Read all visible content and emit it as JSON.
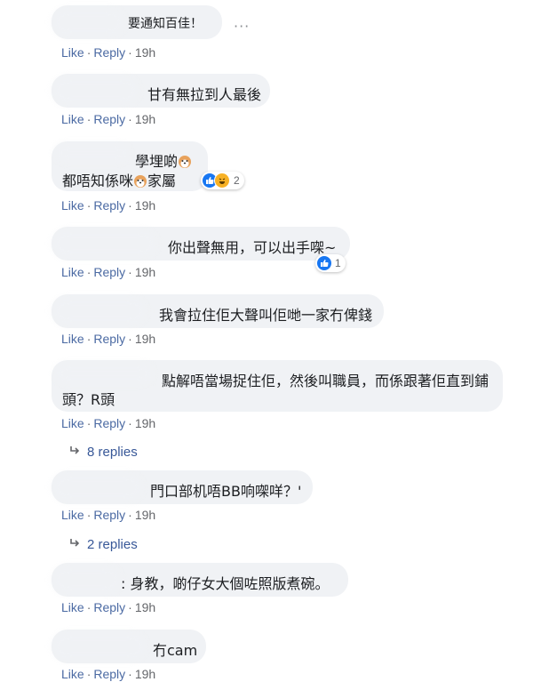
{
  "actions": {
    "like": "Like",
    "reply": "Reply",
    "sep": "·"
  },
  "comments": [
    {
      "text": "要通知百佳！",
      "time": "19h"
    },
    {
      "text": "甘有無拉到人最後",
      "time": "19h"
    },
    {
      "line1": "學埋啲",
      "line2a": "都唔知係咪",
      "line2b": "家屬",
      "time": "19h",
      "reactions": "2"
    },
    {
      "text": "你出聲無用，可以出手㗎~",
      "time": "19h",
      "reactions": "1"
    },
    {
      "text": "我會拉住佢大聲叫佢哋一家冇俾錢",
      "time": "19h"
    },
    {
      "line1": "點解唔當場捉住佢，然後叫職員，而係跟著佢直到鋪",
      "line2": "頭？R頭",
      "time": "19h",
      "replies": "8 replies"
    },
    {
      "text": "門口部机唔BB响㗎咩？'",
      "time": "19h",
      "replies": "2 replies"
    },
    {
      "text": ": 身教，啲仔女大個咗照版煮碗。",
      "time": "19h"
    },
    {
      "text": "冇cam",
      "time": "19h"
    }
  ],
  "more_label": "···"
}
